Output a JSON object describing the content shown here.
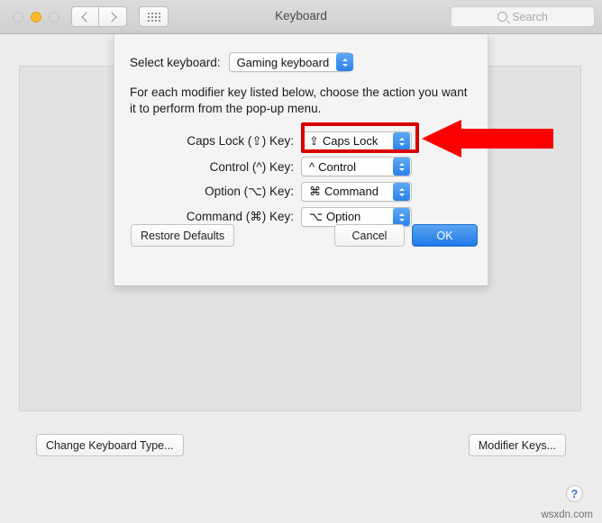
{
  "window": {
    "title": "Keyboard",
    "traffic_lights": [
      "close",
      "minimize",
      "zoom"
    ],
    "nav_back_icon": "chevron-left-icon",
    "nav_forward_icon": "chevron-right-icon",
    "grid_icon": "show-all-grid-icon",
    "search": {
      "placeholder": "Search",
      "value": "",
      "icon": "search-icon"
    }
  },
  "main": {
    "change_keyboard_type_label": "Change Keyboard Type...",
    "modifier_keys_label": "Modifier Keys...",
    "help_label": "?",
    "watermark": "wsxdn.com"
  },
  "sheet": {
    "select_keyboard_label": "Select keyboard:",
    "selected_keyboard": "Gaming keyboard",
    "description": "For each modifier key listed below, choose the action you want it to perform from the pop-up menu.",
    "rows": [
      {
        "label": "Caps Lock (⇪) Key:",
        "symbol": "⇪",
        "value": "Caps Lock",
        "highlighted": true
      },
      {
        "label": "Control (^) Key:",
        "symbol": "^",
        "value": "Control",
        "highlighted": false
      },
      {
        "label": "Option (⌥) Key:",
        "symbol": "⌘",
        "value": "Command",
        "highlighted": false
      },
      {
        "label": "Command (⌘) Key:",
        "symbol": "⌥",
        "value": "Option",
        "highlighted": false
      }
    ],
    "restore_defaults_label": "Restore Defaults",
    "cancel_label": "Cancel",
    "ok_label": "OK"
  },
  "annotation": {
    "arrow_color": "#fa0000",
    "highlight_color": "#d60000",
    "arrow_direction": "left",
    "target": "Caps Lock popup button"
  },
  "colors": {
    "accent_blue": "#2b82ea",
    "window_bg": "#ececec",
    "sheet_bg": "#f4f4f4",
    "panel_bg": "#e2e2e2"
  }
}
